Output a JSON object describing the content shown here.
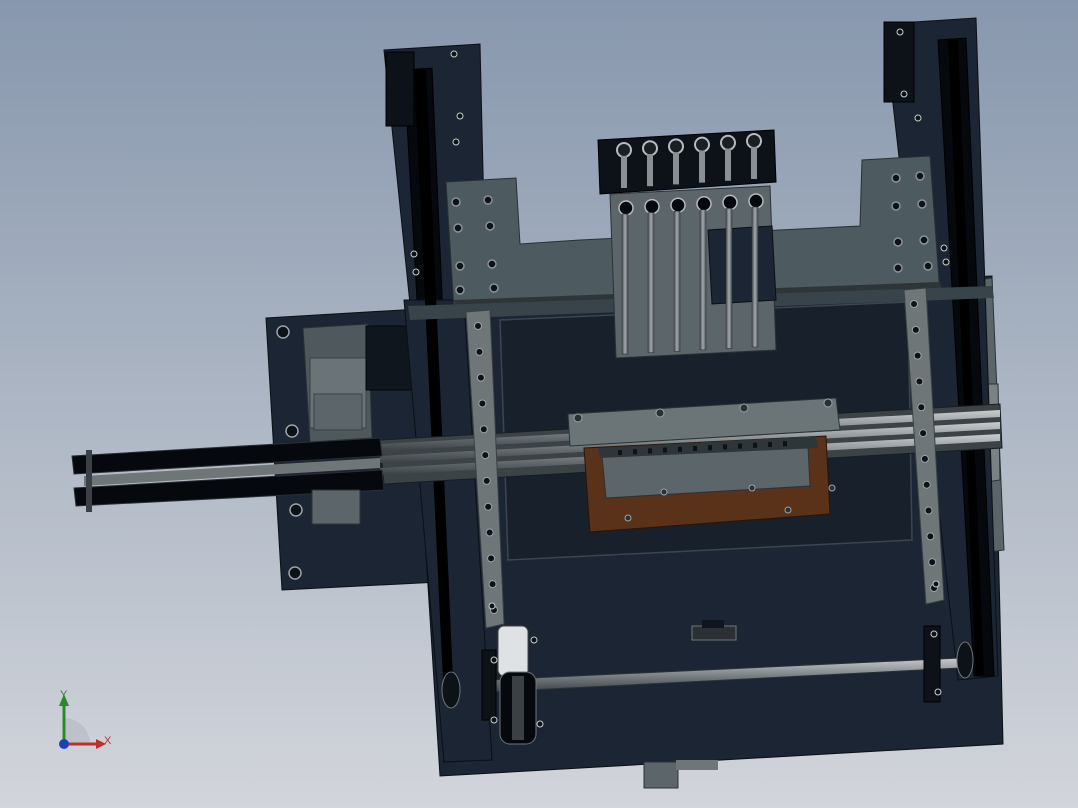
{
  "viewport": {
    "background_top": "#8797ad",
    "background_bottom": "#d2d5db"
  },
  "palette": {
    "frame_dark": "#1c2533",
    "frame_edge": "#0b0f16",
    "plate_gray": "#4d5a5f",
    "plate_light": "#6b7477",
    "rail_gray": "#6f7678",
    "rod_gray": "#8a8f93",
    "clamp_brown": "#5a3119",
    "hole": "#0d1118",
    "screw": "#9aa3a8"
  },
  "triad": {
    "x_label": "X",
    "y_label": "Y",
    "x_color": "#c0302b",
    "y_color": "#2a8a2a",
    "z_color": "#1f3fb8"
  }
}
